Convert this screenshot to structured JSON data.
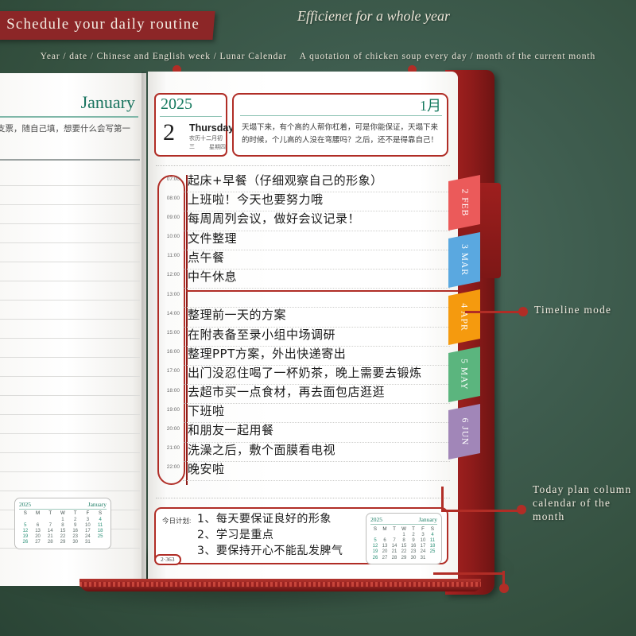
{
  "header": {
    "banner_title": "Schedule your daily routine",
    "tagline": "Efficienet for a whole year",
    "subline_left": "Year / date / Chinese and English week / Lunar Calendar",
    "subline_right": "A quotation of chicken soup every day / month of the current month"
  },
  "colors": {
    "background_green": "#3e5c4e",
    "accent_red": "#b02d26",
    "banner_red": "#8c2627",
    "heading_green": "#167a5f",
    "cover_red": "#8d1b1a"
  },
  "left_page": {
    "month_heading": "January",
    "quote": "生活空白支票，随自己填，想要什么会写第一张！"
  },
  "right_page": {
    "date_box": {
      "year": "2025",
      "day": "2",
      "weekday_en": "Thursday",
      "lunar": "农历十二月初三",
      "weekday_cn": "星期四"
    },
    "quote_box": {
      "month_cn": "1月",
      "text": "天塌下来，有个高的人帮你杠着，可是你能保证，天塌下来的时候，个儿高的人没在弯腰吗？之后，还不是得靠自己！"
    },
    "timeline": [
      {
        "time": "07:00",
        "text": "起床+早餐（仔细观察自己的形象）"
      },
      {
        "time": "08:00",
        "text": "上班啦！今天也要努力哦"
      },
      {
        "time": "09:00",
        "text": "每周周列会议，做好会议记录！"
      },
      {
        "time": "10:00",
        "text": "文件整理"
      },
      {
        "time": "11:00",
        "text": "点午餐"
      },
      {
        "time": "12:00",
        "text": "中午休息"
      },
      {
        "time": "13:00",
        "text": ""
      },
      {
        "time": "14:00",
        "text": "整理前一天的方案"
      },
      {
        "time": "15:00",
        "text": "在附表备至录小组中场调研"
      },
      {
        "time": "16:00",
        "text": "整理PPT方案，外出快递寄出"
      },
      {
        "time": "17:00",
        "text": "出门没忍住喝了一杯奶茶，晚上需要去锻炼"
      },
      {
        "time": "18:00",
        "text": "去超市买一点食材，再去面包店逛逛"
      },
      {
        "time": "19:00",
        "text": "下班啦"
      },
      {
        "time": "20:00",
        "text": "和朋友一起用餐"
      },
      {
        "time": "21:00",
        "text": "洗澡之后，敷个面膜看电视"
      },
      {
        "time": "22:00",
        "text": "晚安啦"
      }
    ],
    "plan": {
      "label": "今日计划:",
      "items": [
        "1、每天要保证良好的形象",
        "2、学习是重点",
        "3、要保持开心不能乱发脾气"
      ]
    },
    "page_number": "2·363"
  },
  "mini_calendar": {
    "year": "2025",
    "month": "January",
    "weekday_headers": [
      "S",
      "M",
      "T",
      "W",
      "T",
      "F",
      "S"
    ],
    "weeks": [
      [
        "",
        "",
        "",
        "1",
        "2",
        "3",
        "4"
      ],
      [
        "5",
        "6",
        "7",
        "8",
        "9",
        "10",
        "11"
      ],
      [
        "12",
        "13",
        "14",
        "15",
        "16",
        "17",
        "18"
      ],
      [
        "19",
        "20",
        "21",
        "22",
        "23",
        "24",
        "25"
      ],
      [
        "26",
        "27",
        "28",
        "29",
        "30",
        "31",
        ""
      ]
    ]
  },
  "index_tabs": [
    {
      "label": "2 FEB",
      "color": "#eb5a5a"
    },
    {
      "label": "3 MAR",
      "color": "#5aa8e0"
    },
    {
      "label": "4 APR",
      "color": "#f59a0e"
    },
    {
      "label": "5 MAY",
      "color": "#5bb57e"
    },
    {
      "label": "6 JUN",
      "color": "#a186b8"
    }
  ],
  "annotations": {
    "timeline_mode": "Timeline mode",
    "today_plan_line1": "Today plan column",
    "today_plan_line2": "calendar of the",
    "today_plan_line3": "month"
  }
}
